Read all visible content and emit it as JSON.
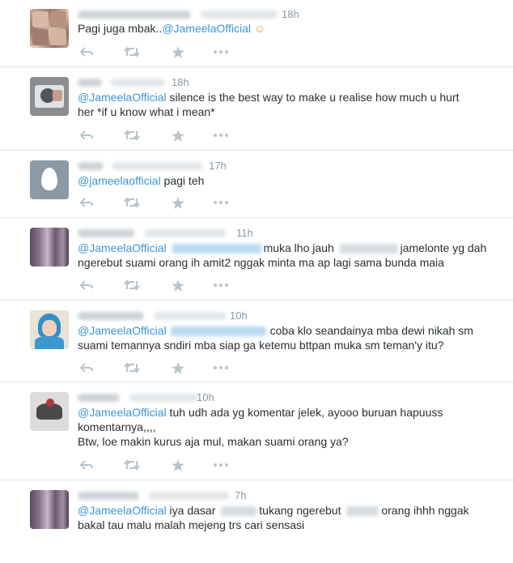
{
  "tweets": [
    {
      "time": "18h",
      "text_parts": [
        "Pagi juga mbak..",
        "@JameelaOfficial",
        " ☺"
      ]
    },
    {
      "time": "18h",
      "text_parts": [
        "@JameelaOfficial",
        " silence is the best way to make u realise how much u hurt",
        "her *if u know what i mean*"
      ]
    },
    {
      "time": "17h",
      "text_parts": [
        "@jameelaofficial",
        " pagi teh"
      ]
    },
    {
      "time": "11h",
      "text_parts": [
        "@JameelaOfficial",
        "muka lho jauh",
        "jamelonte yg dah",
        "ngerebut suami orang ih amit2 nggak minta ma ap lagi sama bunda maia"
      ]
    },
    {
      "time": "10h",
      "text_parts": [
        "@JameelaOfficial",
        "coba klo seandainya mba dewi nikah sm",
        "suami temannya sndiri mba siap ga ketemu bttpan muka sm teman'y itu?"
      ]
    },
    {
      "time": "10h",
      "text_parts": [
        "@JameelaOfficial",
        " tuh udh ada yg komentar jelek, ayooo buruan hapuuss",
        "komentarnya,,,,",
        "Btw, loe makin kurus aja mul, makan suami orang ya?"
      ]
    },
    {
      "time": "7h",
      "text_parts": [
        "@JameelaOfficial",
        " iya dasar",
        "tukang ngerebut",
        "orang ihhh nggak",
        "bakal tau malu malah mejeng trs cari sensasi"
      ]
    }
  ],
  "colors": {
    "mention": "#3b94d9",
    "text": "#292f33",
    "meta": "#8899a6",
    "icon": "#b8c4cc"
  },
  "icons": [
    "reply-icon",
    "retweet-icon",
    "favorite-icon",
    "more-icon"
  ]
}
